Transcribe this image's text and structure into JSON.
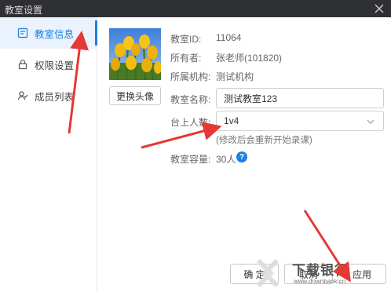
{
  "window": {
    "title": "教室设置"
  },
  "sidebar": {
    "items": [
      {
        "label": "教室信息",
        "icon": "info-card-icon",
        "active": true
      },
      {
        "label": "权限设置",
        "icon": "lock-icon",
        "active": false
      },
      {
        "label": "成员列表",
        "icon": "members-icon",
        "active": false
      }
    ]
  },
  "avatar": {
    "change_label": "更换头像"
  },
  "info": {
    "room_id_label": "教室ID:",
    "room_id": "11064",
    "owner_label": "所有者:",
    "owner": "张老师(101820)",
    "org_label": "所属机构:",
    "org": "测试机构"
  },
  "form": {
    "name_label": "教室名称:",
    "name_value": "测试教室123",
    "seats_label": "台上人数:",
    "seats_value": "1v4",
    "seats_hint": "(修改后会重新开始录课)",
    "capacity_label": "教室容量:",
    "capacity_value": "30人",
    "help_glyph": "?"
  },
  "footer": {
    "ok_label": "确 定",
    "cancel_label": "取消",
    "apply_label": "应用"
  },
  "watermark": {
    "text": "下载银行",
    "sub": "www.downbank.cn"
  },
  "colors": {
    "accent": "#1e7fe0",
    "arrow": "#e53935",
    "titlebar": "#2f3033"
  }
}
